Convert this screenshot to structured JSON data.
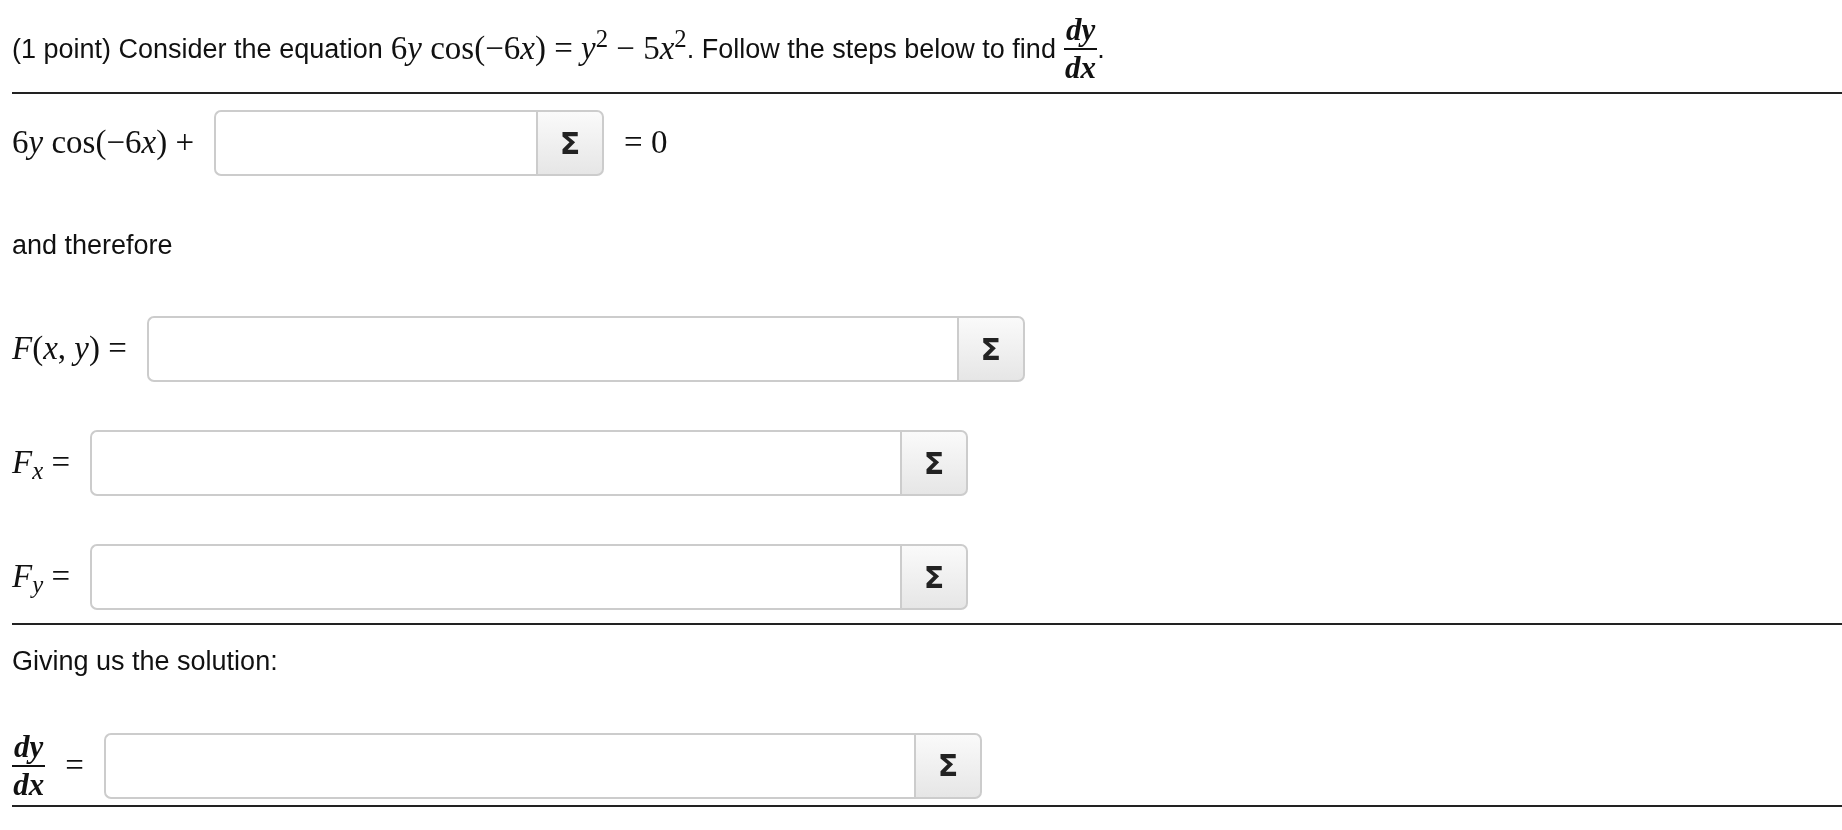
{
  "intro": {
    "prefix": "(1 point) Consider the equation",
    "equation": [
      "6",
      "*y* cos(−6",
      "*x*",
      ") = ",
      "*y*$^{2}$",
      " − 5",
      "*x*$^{2}$"
    ],
    "middle": ". Follow the steps below to find",
    "fraction": {
      "numerator": "dy",
      "denominator": "dx"
    },
    "suffix": "."
  },
  "rows": [
    {
      "kind": "rule"
    },
    {
      "kind": "answer",
      "label": [
        "6",
        "*y* cos(−6",
        "*x*",
        ") +"
      ],
      "button": "Σ",
      "after": "= 0"
    },
    {
      "kind": "text",
      "text": "and therefore"
    },
    {
      "kind": "answer",
      "label": [
        "*F*(*x*, *y*) ="
      ],
      "button": "Σ"
    },
    {
      "kind": "answer",
      "label": [
        "*F*$_{x}$ ="
      ],
      "button": "Σ"
    },
    {
      "kind": "answer",
      "label": [
        "*F*$_{y}$ ="
      ],
      "button": "Σ"
    },
    {
      "kind": "rule"
    },
    {
      "kind": "text",
      "text": "Giving us the solution:"
    },
    {
      "kind": "fraction-answer",
      "numerator": "dy",
      "denominator": "dx",
      "label": [
        "="
      ],
      "button": "Σ"
    },
    {
      "kind": "rule"
    }
  ]
}
